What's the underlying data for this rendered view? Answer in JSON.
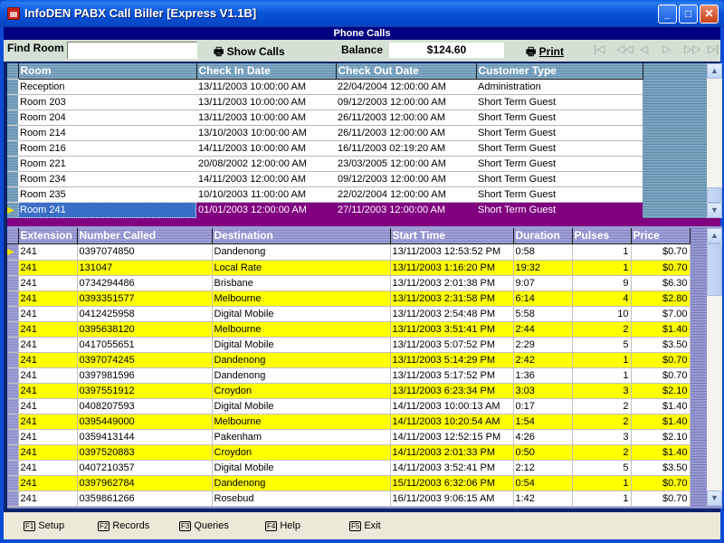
{
  "window": {
    "title": "InfoDEN PABX Call Biller [Express V1.1B]",
    "controls": {
      "minimize": "_",
      "maximize": "□",
      "close": "✕"
    }
  },
  "subheader": "Phone Calls",
  "toolbar": {
    "find_label": "Find Room",
    "find_value": "",
    "show_calls_label": "Show Calls",
    "balance_label": "Balance",
    "balance_value": "$124.60",
    "print_label": "Print",
    "nav": [
      "first",
      "prev-page",
      "prev",
      "next",
      "next-page",
      "last"
    ]
  },
  "rooms": {
    "columns": [
      "Room",
      "Check In Date",
      "Check Out Date",
      "Customer Type"
    ],
    "rows": [
      [
        "Reception",
        "13/11/2003  10:00:00 AM",
        "22/04/2004  12:00:00 AM",
        "Administration"
      ],
      [
        "Room 203",
        "13/11/2003  10:00:00 AM",
        "09/12/2003  12:00:00 AM",
        "Short Term Guest"
      ],
      [
        "Room 204",
        "13/11/2003  10:00:00 AM",
        "26/11/2003  12:00:00 AM",
        "Short Term Guest"
      ],
      [
        "Room 214",
        "13/10/2003  10:00:00 AM",
        "26/11/2003  12:00:00 AM",
        "Short Term Guest"
      ],
      [
        "Room 216",
        "14/11/2003  10:00:00 AM",
        "16/11/2003  02:19:20 AM",
        "Short Term Guest"
      ],
      [
        "Room 221",
        "20/08/2002  12:00:00 AM",
        "23/03/2005  12:00:00 AM",
        "Short Term Guest"
      ],
      [
        "Room 234",
        "14/11/2003  12:00:00 AM",
        "09/12/2003  12:00:00 AM",
        "Short Term Guest"
      ],
      [
        "Room 235",
        "10/10/2003  11:00:00 AM",
        "22/02/2004  12:00:00 AM",
        "Short Term Guest"
      ],
      [
        "Room 241",
        "01/01/2003  12:00:00 AM",
        "27/11/2003  12:00:00 AM",
        "Short Term Guest"
      ]
    ],
    "selected_index": 8
  },
  "calls": {
    "columns": [
      "Extension",
      "Number Called",
      "Destination",
      "Start Time",
      "Duration",
      "Pulses",
      "Price"
    ],
    "rows": [
      [
        "241",
        "0397074850",
        "Dandenong",
        "13/11/2003 12:53:52 PM",
        "0:58",
        "1",
        "$0.70"
      ],
      [
        "241",
        "131047",
        "Local Rate",
        "13/11/2003 1:16:20 PM",
        "19:32",
        "1",
        "$0.70"
      ],
      [
        "241",
        "0734294486",
        "Brisbane",
        "13/11/2003 2:01:38 PM",
        "9:07",
        "9",
        "$6.30"
      ],
      [
        "241",
        "0393351577",
        "Melbourne",
        "13/11/2003 2:31:58 PM",
        "6:14",
        "4",
        "$2.80"
      ],
      [
        "241",
        "0412425958",
        "Digital Mobile",
        "13/11/2003 2:54:48 PM",
        "5:58",
        "10",
        "$7.00"
      ],
      [
        "241",
        "0395638120",
        "Melbourne",
        "13/11/2003 3:51:41 PM",
        "2:44",
        "2",
        "$1.40"
      ],
      [
        "241",
        "0417055651",
        "Digital Mobile",
        "13/11/2003 5:07:52 PM",
        "2:29",
        "5",
        "$3.50"
      ],
      [
        "241",
        "0397074245",
        "Dandenong",
        "13/11/2003 5:14:29 PM",
        "2:42",
        "1",
        "$0.70"
      ],
      [
        "241",
        "0397981596",
        "Dandenong",
        "13/11/2003 5:17:52 PM",
        "1:36",
        "1",
        "$0.70"
      ],
      [
        "241",
        "0397551912",
        "Croydon",
        "13/11/2003 6:23:34 PM",
        "3:03",
        "3",
        "$2.10"
      ],
      [
        "241",
        "0408207593",
        "Digital Mobile",
        "14/11/2003 10:00:13 AM",
        "0:17",
        "2",
        "$1.40"
      ],
      [
        "241",
        "0395449000",
        "Melbourne",
        "14/11/2003 10:20:54 AM",
        "1:54",
        "2",
        "$1.40"
      ],
      [
        "241",
        "0359413144",
        "Pakenham",
        "14/11/2003 12:52:15 PM",
        "4:26",
        "3",
        "$2.10"
      ],
      [
        "241",
        "0397520883",
        "Croydon",
        "14/11/2003 2:01:33 PM",
        "0:50",
        "2",
        "$1.40"
      ],
      [
        "241",
        "0407210357",
        "Digital Mobile",
        "14/11/2003 3:52:41 PM",
        "2:12",
        "5",
        "$3.50"
      ],
      [
        "241",
        "0397962784",
        "Dandenong",
        "15/11/2003 6:32:06 PM",
        "0:54",
        "1",
        "$0.70"
      ],
      [
        "241",
        "0359861266",
        "Rosebud",
        "16/11/2003 9:06:15 AM",
        "1:42",
        "1",
        "$0.70"
      ]
    ]
  },
  "footer": {
    "keys": [
      {
        "key": "F1",
        "label": "Setup"
      },
      {
        "key": "F2",
        "label": "Records"
      },
      {
        "key": "F3",
        "label": "Queries"
      },
      {
        "key": "F4",
        "label": "Help"
      },
      {
        "key": "F5",
        "label": "Exit"
      }
    ]
  },
  "colors": {
    "title_blue": "#0852d8",
    "subheader_navy": "#000080",
    "selection_purple": "#800080",
    "alt_row_yellow": "#ffff00"
  }
}
